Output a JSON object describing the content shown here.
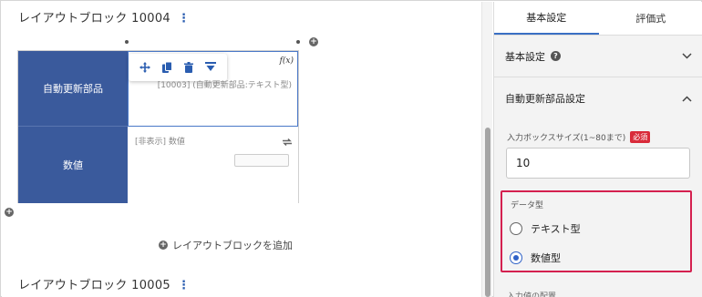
{
  "canvas": {
    "block1_title": "レイアウトブロック 10004",
    "block2_title": "レイアウトブロック 10005",
    "block_menu_glyph": "⋮",
    "row1_label": "自動更新部品",
    "row2_label": "数値",
    "row1_fx": "f(x)",
    "row1_field_ref": "[10003] (自動更新部品:テキスト型)",
    "row2_hidden_label": "[非表示] 数値",
    "add_block_label": "レイアウトブロックを追加",
    "toolbar_icons": [
      "move-icon",
      "copy-icon",
      "trash-icon",
      "collapse-icon"
    ],
    "colors": {
      "label_bg": "#3a5a9c",
      "accent": "#3a6fc4"
    }
  },
  "panel": {
    "tabs": [
      {
        "label": "基本設定",
        "active": true
      },
      {
        "label": "評価式",
        "active": false
      }
    ],
    "section_basic": "基本設定",
    "section_auto": "自動更新部品設定",
    "box_size_label": "入力ボックスサイズ(1~80まで)",
    "required_badge": "必須",
    "box_size_value": "10",
    "data_type_label": "データ型",
    "data_type_options": [
      {
        "label": "テキスト型",
        "checked": false
      },
      {
        "label": "数値型",
        "checked": true
      }
    ],
    "cut_label": "入力値の配置",
    "colors": {
      "highlight": "#d4204f",
      "required": "#d92b3a"
    }
  }
}
